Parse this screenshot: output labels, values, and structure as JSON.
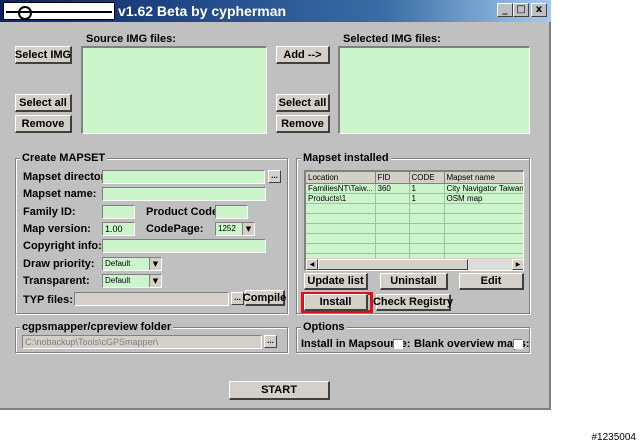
{
  "window": {
    "title": "v1.62 Beta by cypherman",
    "minimize": "_",
    "maximize": "□",
    "close": "x"
  },
  "source_img": {
    "label": "Source IMG files:",
    "select_button": "Select IMG",
    "select_all_button": "Select all",
    "remove_button": "Remove"
  },
  "add_button": "Add -->",
  "selected_img": {
    "label": "Selected IMG files:",
    "select_all_button": "Select all",
    "remove_button": "Remove"
  },
  "create_mapset": {
    "title": "Create MAPSET",
    "mapset_directory_label": "Mapset directory:",
    "mapset_directory_value": "",
    "browse_button": "...",
    "mapset_name_label": "Mapset name:",
    "mapset_name_value": "",
    "family_id_label": "Family ID:",
    "family_id_value": "",
    "product_code_label": "Product Code:",
    "product_code_value": "",
    "map_version_label": "Map version:",
    "map_version_value": "1.00",
    "codepage_label": "CodePage:",
    "codepage_value": "1252",
    "copyright_label": "Copyright info:",
    "copyright_value": "",
    "draw_priority_label": "Draw priority:",
    "draw_priority_value": "Default",
    "transparent_label": "Transparent:",
    "transparent_value": "Default",
    "typ_label": "TYP files:",
    "typ_value": "",
    "typ_browse": "...",
    "compile_button": "Compile"
  },
  "mapset_installed": {
    "title": "Mapset installed",
    "columns": [
      "Location",
      "FID",
      "CODE",
      "Mapset name"
    ],
    "rows": [
      [
        "FamiliesNT\\Taiw...",
        "360",
        "1",
        "City Navigator Taiwan N"
      ],
      [
        "Products\\1",
        "",
        "1",
        "OSM map"
      ]
    ],
    "scroll_left": "◀",
    "scroll_right": "▶",
    "update_button": "Update list",
    "uninstall_button": "Uninstall",
    "edit_button": "Edit",
    "install_button": "Install",
    "check_registry_button": "Check Registry"
  },
  "cgpsmapper": {
    "title": "cgpsmapper/cpreview folder",
    "path_value": "C:\\nobackup\\Tools\\cGPSmapper\\",
    "browse_button": "..."
  },
  "options": {
    "title": "Options",
    "install_mapsource_label": "Install in Mapsource:",
    "install_mapsource_checked": false,
    "blank_overview_label": "Blank overview maps:",
    "blank_overview_checked": false
  },
  "start_button": "START",
  "watermark": "#1235004",
  "colors": {
    "title_bar": "#0a246a",
    "list_background": "#ccf5cc",
    "highlight": "#e0101a",
    "window_face": "#c0c0c0"
  }
}
